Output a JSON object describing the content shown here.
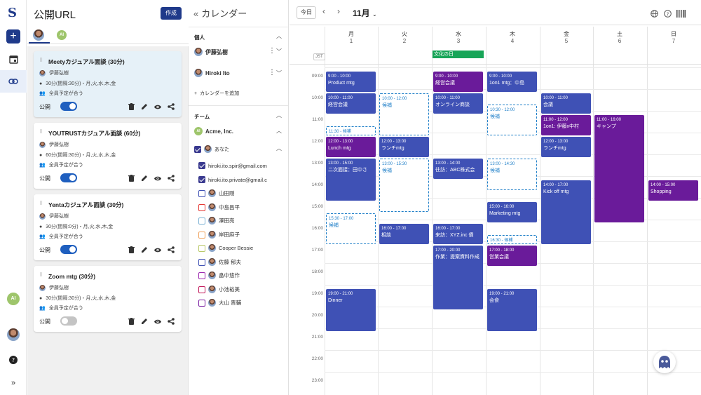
{
  "rail": {
    "logo": "S",
    "new_label": "+"
  },
  "avatar_ai": "AI",
  "public_url": {
    "title": "公開URL",
    "create_label": "作成",
    "cards": [
      {
        "title": "Meetyカジュアル面談 (30分)",
        "owner": "伊藤弘樹",
        "schedule": "30分(間隔:30分)・月,火,水,木,金",
        "participants": "全員予定が合う",
        "public_label": "公開",
        "public_on": true
      },
      {
        "title": "YOUTRUSTカジュアル面談 (60分)",
        "owner": "伊藤弘樹",
        "schedule": "60分(間隔:30分)・月,火,水,木,金",
        "participants": "全員予定が合う",
        "public_label": "公開",
        "public_on": true
      },
      {
        "title": "Yentaカジュアル面談 (30分)",
        "owner": "伊藤弘樹",
        "schedule": "30分(間隔:0分)・月,火,水,木,金",
        "participants": "全員予定が合う",
        "public_label": "公開",
        "public_on": true
      },
      {
        "title": "Zoom mtg (30分)",
        "owner": "伊藤弘樹",
        "schedule": "30分(間隔:30分)・月,火,水,木,金",
        "participants": "全員予定が合う",
        "public_label": "公開",
        "public_on": false
      }
    ]
  },
  "calendars": {
    "title": "カレンダー",
    "personal_label": "個人",
    "personal": [
      "伊藤弘樹",
      "Hiroki Ito"
    ],
    "add_label": "カレンダーを追加",
    "team_label": "チーム",
    "team_name": "Acme, Inc.",
    "you_label": "あなた",
    "members": [
      {
        "name": "hiroki.ito.spir@gmail.com",
        "checked": true,
        "color": "#3a3a8f"
      },
      {
        "name": "hiroki.ito.private@gmail.c",
        "checked": true,
        "color": "#3a3a8f"
      },
      {
        "name": "山田剛",
        "checked": false,
        "color": "#3f51b5"
      },
      {
        "name": "中島昌平",
        "checked": false,
        "color": "#e53935"
      },
      {
        "name": "澤田亮",
        "checked": false,
        "color": "#7fb3d5"
      },
      {
        "name": "岸田麻子",
        "checked": false,
        "color": "#f0a35e"
      },
      {
        "name": "Cooper Bessie",
        "checked": false,
        "color": "#b9c96a"
      },
      {
        "name": "佐藤 郁夫",
        "checked": false,
        "color": "#3f51b5"
      },
      {
        "name": "畠中悠作",
        "checked": false,
        "color": "#9c27b0"
      },
      {
        "name": "小池裕美",
        "checked": false,
        "color": "#c2185b"
      },
      {
        "name": "大山 晋輔",
        "checked": false,
        "color": "#7b1fa2"
      }
    ]
  },
  "main": {
    "today_label": "今日",
    "month_label": "11月",
    "timezone": "JST",
    "days": [
      {
        "name": "月",
        "num": "1"
      },
      {
        "name": "火",
        "num": "2"
      },
      {
        "name": "水",
        "num": "3"
      },
      {
        "name": "木",
        "num": "4"
      },
      {
        "name": "金",
        "num": "5"
      },
      {
        "name": "土",
        "num": "6"
      },
      {
        "name": "日",
        "num": "7"
      }
    ],
    "holiday": "文化の日",
    "hours": [
      "09:00",
      "10:00",
      "11:00",
      "12:00",
      "13:00",
      "14:00",
      "15:00",
      "16:00",
      "17:00",
      "18:00",
      "19:00",
      "20:00",
      "21:00",
      "22:00",
      "23:00"
    ],
    "events": [
      {
        "day": 0,
        "start": 9,
        "end": 10,
        "time": "9:00 - 10:00",
        "title": "Product mtg",
        "kind": "b"
      },
      {
        "day": 0,
        "start": 10,
        "end": 11,
        "time": "10:00 - 11:00",
        "title": "経営会議",
        "kind": "b"
      },
      {
        "day": 0,
        "start": 11.5,
        "end": 12,
        "time": "11:30 - 候補",
        "title": "",
        "kind": "c"
      },
      {
        "day": 0,
        "start": 12,
        "end": 13,
        "time": "12:00 - 13:00",
        "title": "Lunch mtg",
        "kind": "p"
      },
      {
        "day": 0,
        "start": 13,
        "end": 15,
        "time": "13:00 - 15:00",
        "title": "二次面接：田中さ",
        "kind": "b"
      },
      {
        "day": 0,
        "start": 15.5,
        "end": 17,
        "time": "15:30 - 17:00",
        "title": "候補",
        "kind": "c"
      },
      {
        "day": 0,
        "start": 19,
        "end": 21,
        "time": "19:00 - 21:00",
        "title": "Dinner",
        "kind": "b"
      },
      {
        "day": 1,
        "start": 10,
        "end": 12,
        "time": "10:00 - 12:00",
        "title": "候補",
        "kind": "c"
      },
      {
        "day": 1,
        "start": 12,
        "end": 13,
        "time": "12:00 - 13:00",
        "title": "ランチmtg",
        "kind": "b"
      },
      {
        "day": 1,
        "start": 13,
        "end": 15.5,
        "time": "13:00 - 15:30",
        "title": "候補",
        "kind": "c"
      },
      {
        "day": 1,
        "start": 16,
        "end": 17,
        "time": "16:00 - 17:00",
        "title": "相談",
        "kind": "b"
      },
      {
        "day": 2,
        "start": 9,
        "end": 10,
        "time": "9:00 - 10:00",
        "title": "経営会議",
        "kind": "p"
      },
      {
        "day": 2,
        "start": 10,
        "end": 11,
        "time": "10:00 - 11:00",
        "title": "オンライン商談",
        "kind": "b"
      },
      {
        "day": 2,
        "start": 13,
        "end": 14,
        "time": "13:00 - 14:00",
        "title": "往訪：ABC株式会",
        "kind": "b"
      },
      {
        "day": 2,
        "start": 16,
        "end": 17,
        "time": "16:00 - 17:00",
        "title": "来訪：XYZ.inc 債",
        "kind": "b"
      },
      {
        "day": 2,
        "start": 17,
        "end": 20,
        "time": "17:00 - 20:00",
        "title": "作業：提案資料作成",
        "kind": "b"
      },
      {
        "day": 3,
        "start": 9,
        "end": 10,
        "time": "9:00 - 10:00",
        "title": "1on1 mtg：中島",
        "kind": "b"
      },
      {
        "day": 3,
        "start": 10.5,
        "end": 12,
        "time": "10:30 - 12:00",
        "title": "候補",
        "kind": "c"
      },
      {
        "day": 3,
        "start": 13,
        "end": 14.5,
        "time": "13:00 - 14:30",
        "title": "候補",
        "kind": "c"
      },
      {
        "day": 3,
        "start": 15,
        "end": 16,
        "time": "15:00 - 16:00",
        "title": "Marketing mtg",
        "kind": "b"
      },
      {
        "day": 3,
        "start": 16.5,
        "end": 17,
        "time": "16:30 - 候補",
        "title": "",
        "kind": "c"
      },
      {
        "day": 3,
        "start": 17,
        "end": 18,
        "time": "17:00 - 18:00",
        "title": "営業会議",
        "kind": "p"
      },
      {
        "day": 3,
        "start": 19,
        "end": 21,
        "time": "19:00 - 21:00",
        "title": "会食",
        "kind": "b"
      },
      {
        "day": 4,
        "start": 10,
        "end": 11,
        "time": "10:00 - 11:00",
        "title": "会議",
        "kind": "b"
      },
      {
        "day": 4,
        "start": 11,
        "end": 12,
        "time": "11:00 - 12:00",
        "title": "1on1: 伊藤x中村",
        "kind": "p"
      },
      {
        "day": 4,
        "start": 12,
        "end": 13,
        "time": "12:00 - 13:00",
        "title": "ランチmtg",
        "kind": "b"
      },
      {
        "day": 4,
        "start": 14,
        "end": 17,
        "time": "14:00 - 17:00",
        "title": "Kick off mtg",
        "kind": "b"
      },
      {
        "day": 5,
        "start": 11,
        "end": 16,
        "time": "11:00 - 16:00",
        "title": "キャンプ",
        "kind": "p"
      },
      {
        "day": 6,
        "start": 14,
        "end": 15,
        "time": "14:00 - 15:00",
        "title": "Shopping",
        "kind": "p"
      }
    ]
  }
}
